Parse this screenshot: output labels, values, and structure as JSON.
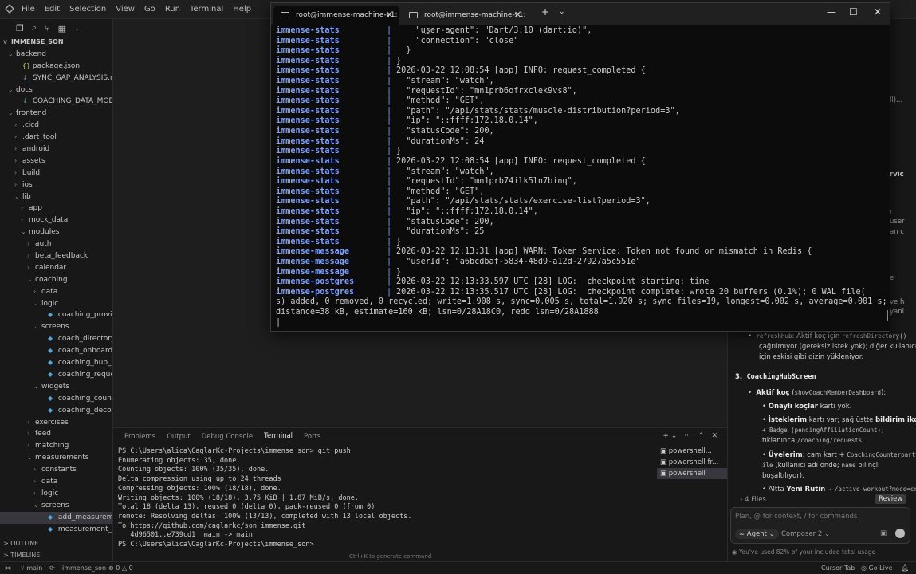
{
  "menu": [
    "File",
    "Edit",
    "Selection",
    "View",
    "Go",
    "Run",
    "Terminal",
    "Help"
  ],
  "explorer": {
    "root": "IMMENSE_SON",
    "rows": [
      {
        "d": 1,
        "c": "v",
        "i": "",
        "t": "backend"
      },
      {
        "d": 2,
        "c": "",
        "i": "{}",
        "k": "json",
        "t": "package.json"
      },
      {
        "d": 2,
        "c": "",
        "i": "↓",
        "k": "md",
        "t": "SYNC_GAP_ANALYSIS.md"
      },
      {
        "d": 1,
        "c": "v",
        "i": "",
        "t": "docs"
      },
      {
        "d": 2,
        "c": "",
        "i": "↓",
        "k": "md",
        "t": "COACHING_DATA_MODEL.md"
      },
      {
        "d": 1,
        "c": "v",
        "i": "",
        "t": "frontend"
      },
      {
        "d": 2,
        "c": ">",
        "i": "",
        "t": ".cicd"
      },
      {
        "d": 2,
        "c": ">",
        "i": "",
        "t": ".dart_tool"
      },
      {
        "d": 2,
        "c": ">",
        "i": "",
        "t": "android"
      },
      {
        "d": 2,
        "c": ">",
        "i": "",
        "t": "assets"
      },
      {
        "d": 2,
        "c": ">",
        "i": "",
        "t": "build"
      },
      {
        "d": 2,
        "c": ">",
        "i": "",
        "t": "ios"
      },
      {
        "d": 2,
        "c": "v",
        "i": "",
        "t": "lib"
      },
      {
        "d": 3,
        "c": ">",
        "i": "",
        "t": "app"
      },
      {
        "d": 3,
        "c": ">",
        "i": "",
        "t": "mock_data"
      },
      {
        "d": 3,
        "c": "v",
        "i": "",
        "t": "modules"
      },
      {
        "d": 4,
        "c": ">",
        "i": "",
        "t": "auth"
      },
      {
        "d": 4,
        "c": ">",
        "i": "",
        "t": "beta_feedback"
      },
      {
        "d": 4,
        "c": ">",
        "i": "",
        "t": "calendar"
      },
      {
        "d": 4,
        "c": "v",
        "i": "",
        "t": "coaching"
      },
      {
        "d": 5,
        "c": ">",
        "i": "",
        "t": "data"
      },
      {
        "d": 5,
        "c": "v",
        "i": "",
        "t": "logic"
      },
      {
        "d": 6,
        "c": "",
        "i": "◆",
        "k": "dart",
        "t": "coaching_provider.dart"
      },
      {
        "d": 5,
        "c": "v",
        "i": "",
        "t": "screens"
      },
      {
        "d": 6,
        "c": "",
        "i": "◆",
        "k": "dart",
        "t": "coach_directory_scree..."
      },
      {
        "d": 6,
        "c": "",
        "i": "◆",
        "k": "dart",
        "t": "coach_onboarding_scr..."
      },
      {
        "d": 6,
        "c": "",
        "i": "◆",
        "k": "dart",
        "t": "coaching_hub_screen...."
      },
      {
        "d": 6,
        "c": "",
        "i": "◆",
        "k": "dart",
        "t": "coaching_requests_scr..."
      },
      {
        "d": 5,
        "c": "v",
        "i": "",
        "t": "widgets"
      },
      {
        "d": 6,
        "c": "",
        "i": "◆",
        "k": "dart",
        "t": "coaching_counterpart..."
      },
      {
        "d": 6,
        "c": "",
        "i": "◆",
        "k": "dart",
        "t": "coaching_decor.dart"
      },
      {
        "d": 4,
        "c": ">",
        "i": "",
        "t": "exercises"
      },
      {
        "d": 4,
        "c": ">",
        "i": "",
        "t": "feed"
      },
      {
        "d": 4,
        "c": ">",
        "i": "",
        "t": "matching"
      },
      {
        "d": 4,
        "c": "v",
        "i": "",
        "t": "measurements"
      },
      {
        "d": 5,
        "c": ">",
        "i": "",
        "t": "constants"
      },
      {
        "d": 5,
        "c": ">",
        "i": "",
        "t": "data"
      },
      {
        "d": 5,
        "c": ">",
        "i": "",
        "t": "logic"
      },
      {
        "d": 5,
        "c": "v",
        "i": "",
        "t": "screens"
      },
      {
        "d": 6,
        "c": "",
        "i": "◆",
        "k": "dart",
        "t": "add_measurement_scr...",
        "sel": true
      },
      {
        "d": 6,
        "c": "",
        "i": "◆",
        "k": "dart",
        "t": "measurement_detail_s..."
      }
    ],
    "outline": "OUTLINE",
    "timeline": "TIMELINE"
  },
  "windows_terminal": {
    "tab1": "root@immense-machine-v1: ·",
    "tab2": "root@immense-machine-v1: ~",
    "lines": [
      {
        "s": "immense-stats",
        "p": "|",
        "t": "    \"user-agent\": \"Dart/3.10 (dart:io)\","
      },
      {
        "s": "immense-stats",
        "p": "|",
        "t": "    \"connection\": \"close\""
      },
      {
        "s": "immense-stats",
        "p": "|",
        "t": "  }"
      },
      {
        "s": "immense-stats",
        "p": "|",
        "t": "}"
      },
      {
        "s": "immense-stats",
        "p": "|",
        "t": "2026-03-22 12:08:54 [app] INFO: request_completed {"
      },
      {
        "s": "immense-stats",
        "p": "|",
        "t": "  \"stream\": \"watch\","
      },
      {
        "s": "immense-stats",
        "p": "|",
        "t": "  \"requestId\": \"mn1prb6ofrxclek9vs8\","
      },
      {
        "s": "immense-stats",
        "p": "|",
        "t": "  \"method\": \"GET\","
      },
      {
        "s": "immense-stats",
        "p": "|",
        "t": "  \"path\": \"/api/stats/stats/muscle-distribution?period=3\","
      },
      {
        "s": "immense-stats",
        "p": "|",
        "t": "  \"ip\": \"::ffff:172.18.0.14\","
      },
      {
        "s": "immense-stats",
        "p": "|",
        "t": "  \"statusCode\": 200,"
      },
      {
        "s": "immense-stats",
        "p": "|",
        "t": "  \"durationMs\": 24"
      },
      {
        "s": "immense-stats",
        "p": "|",
        "t": "}"
      },
      {
        "s": "immense-stats",
        "p": "|",
        "t": "2026-03-22 12:08:54 [app] INFO: request_completed {"
      },
      {
        "s": "immense-stats",
        "p": "|",
        "t": "  \"stream\": \"watch\","
      },
      {
        "s": "immense-stats",
        "p": "|",
        "t": "  \"requestId\": \"mn1prb74ilk5ln7binq\","
      },
      {
        "s": "immense-stats",
        "p": "|",
        "t": "  \"method\": \"GET\","
      },
      {
        "s": "immense-stats",
        "p": "|",
        "t": "  \"path\": \"/api/stats/stats/exercise-list?period=3\","
      },
      {
        "s": "immense-stats",
        "p": "|",
        "t": "  \"ip\": \"::ffff:172.18.0.14\","
      },
      {
        "s": "immense-stats",
        "p": "|",
        "t": "  \"statusCode\": 200,"
      },
      {
        "s": "immense-stats",
        "p": "|",
        "t": "  \"durationMs\": 25"
      },
      {
        "s": "immense-stats",
        "p": "|",
        "t": "}"
      },
      {
        "s": "immense-message",
        "p": "|",
        "t": "2026-03-22 12:13:31 [app] WARN: Token Service: Token not found or mismatch in Redis {"
      },
      {
        "s": "immense-message",
        "p": "|",
        "t": "  \"userId\": \"a6bcdbaf-5834-48d9-a12d-27927a5c551e\""
      },
      {
        "s": "immense-message",
        "p": "|",
        "t": "}"
      },
      {
        "s": "immense-postgres",
        "p": "|",
        "t": "2026-03-22 12:13:33.597 UTC [28] LOG:  checkpoint starting: time"
      },
      {
        "s": "immense-postgres",
        "p": "|",
        "t": "2026-03-22 12:13:35.517 UTC [28] LOG:  checkpoint complete: wrote 20 buffers (0.1%); 0 WAL file("
      }
    ],
    "wrap": "s) added, 0 removed, 0 recycled; write=1.908 s, sync=0.005 s, total=1.920 s; sync files=19, longest=0.002 s, average=0.001 s; distance=38 kB, estimate=160 kB; lsn=0/28A18C0, redo lsn=0/28A1888"
  },
  "panel": {
    "tabs": [
      "Problems",
      "Output",
      "Debug Console",
      "Terminal",
      "Ports"
    ],
    "active_tab": "Terminal",
    "terminal_lines": [
      "PS C:\\Users\\alica\\CaglarKc-Projects\\immense_son> git push",
      "Enumerating objects: 35, done.",
      "Counting objects: 100% (35/35), done.",
      "Delta compression using up to 24 threads",
      "Compressing objects: 100% (18/18), done.",
      "Writing objects: 100% (18/18), 3.75 KiB | 1.87 MiB/s, done.",
      "Total 18 (delta 13), reused 0 (delta 0), pack-reused 0 (from 0)",
      "remote: Resolving deltas: 100% (13/13), completed with 13 local objects.",
      "To https://github.com/caglarkc/son_immense.git",
      "   4d96501..e739cd1  main -> main",
      "PS C:\\Users\\alica\\CaglarKc-Projects\\immense_son> "
    ],
    "sessions": [
      "powershell...",
      "powershell fr...",
      "powershell"
    ],
    "hint": "Ctrl+K to generate command"
  },
  "chat": {
    "refresh_label": "refreshHub",
    "refresh_text": ": Aktif koç için",
    "refresh_code": "refreshDirectory()",
    "refresh_l2": "çağrılmıyor (gereksiz istek yok); diğer kullanıcılar",
    "refresh_l3": "için eskisi gibi dizin yükleniyor.",
    "heading": "CoachingHubScreen",
    "heading_num": "3.",
    "active_coach": "Aktif koç",
    "active_code": "showCoachMemberDashboard",
    "approved_b": "Onaylı koçlar",
    "approved_t": " kartı yok.",
    "requests_b": "İsteklerim",
    "requests_t": " kartı var; sağ üstte ",
    "notif_b": "bildirim ikonu",
    "badge_code": "+ Badge (",
    "badge_code2": "pendingAffiliationCount",
    "badge_tail": ");",
    "tap_text": "tıklanınca",
    "tap_code": "/coaching/requests",
    "members_b": "Üyelerim",
    "members_t": ": cam kart +",
    "members_code": "CoachingCounterpartyT",
    "members_code2": "ile",
    "members_t2": " (kullanıcı adı önde;",
    "members_code3": "name",
    "members_t3": " bilinçli",
    "members_t4": "boşaltılıyor).",
    "routine_t": "Altta ",
    "routine_b": "Yeni Rutin",
    "routine_code": "→ /active-workout?mode=cr",
    "files": "4 Files",
    "review": "Review",
    "input_placeholder": "Plan, @ for context, / for commands",
    "agent": "Agent",
    "composer": "Composer 2",
    "usage": "You've used 82% of your included total usage",
    "partial": [
      "ll)...",
      "rvic",
      "r",
      "user",
      "an c",
      "e",
      "ve h",
      "yani"
    ]
  },
  "status": {
    "branch": "main",
    "project": "immense_son",
    "problems": "0",
    "warnings": "0",
    "cursor_tab": "Cursor Tab",
    "go_live": "Go Live"
  }
}
